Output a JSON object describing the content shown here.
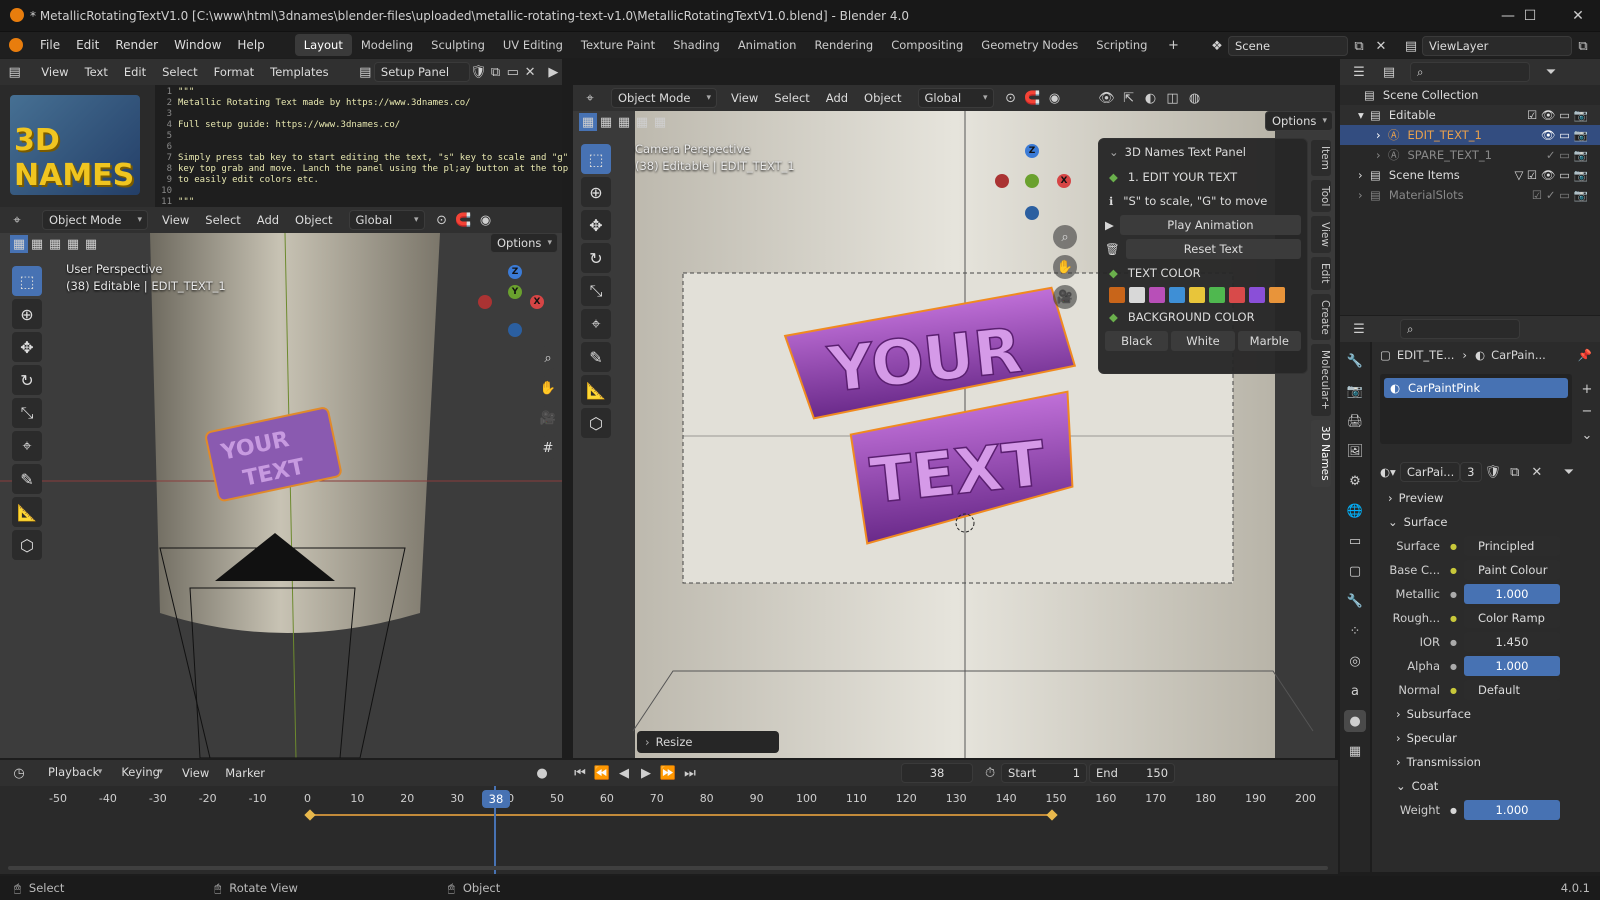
{
  "window": {
    "title": "* MetallicRotatingTextV1.0 [C:\\www\\html\\3dnames\\blender-files\\uploaded\\metallic-rotating-text-v1.0\\MetallicRotatingTextV1.0.blend] - Blender 4.0"
  },
  "menu": [
    "File",
    "Edit",
    "Render",
    "Window",
    "Help"
  ],
  "workspaces": [
    "Layout",
    "Modeling",
    "Sculpting",
    "UV Editing",
    "Texture Paint",
    "Shading",
    "Animation",
    "Rendering",
    "Compositing",
    "Geometry Nodes",
    "Scripting"
  ],
  "active_workspace": "Layout",
  "scene": {
    "name": "Scene",
    "view_layer": "ViewLayer"
  },
  "text_editor": {
    "menus": [
      "View",
      "Text",
      "Edit",
      "Select",
      "Format",
      "Templates"
    ],
    "file": "Setup Panel",
    "lines": [
      {
        "n": "1",
        "t": "\"\"\""
      },
      {
        "n": "2",
        "t": "Metallic Rotating Text made by https://www.3dnames.co/"
      },
      {
        "n": "3",
        "t": ""
      },
      {
        "n": "4",
        "t": "Full setup guide: https://www.3dnames.co/"
      },
      {
        "n": "5",
        "t": ""
      },
      {
        "n": "6",
        "t": ""
      },
      {
        "n": "7",
        "t": "Simply press tab key to start editing the text, \"s\" key to scale and \"g\""
      },
      {
        "n": "8",
        "t": "key top grab and move. Lanch the panel using the pl;ay button at the top"
      },
      {
        "n": "9",
        "t": "to easily edit colors etc."
      },
      {
        "n": "10",
        "t": ""
      },
      {
        "n": "11",
        "t": "\"\"\""
      }
    ]
  },
  "logo": {
    "text": "3D NAMES"
  },
  "left_viewport": {
    "mode": "Object Mode",
    "menus": [
      "View",
      "Select",
      "Add",
      "Object"
    ],
    "transform": "Global",
    "options": "Options",
    "title": "User Perspective",
    "subtitle": "(38) Editable | EDIT_TEXT_1"
  },
  "right_viewport": {
    "mode": "Object Mode",
    "menus": [
      "View",
      "Select",
      "Add",
      "Object"
    ],
    "transform": "Global",
    "options": "Options",
    "title": "Camera Perspective",
    "subtitle": "(38) Editable | EDIT_TEXT_1",
    "resize": "Resize"
  },
  "side_tabs": [
    "Item",
    "Tool",
    "View",
    "Edit",
    "Create",
    "Molecular+",
    "3D Names"
  ],
  "names_panel": {
    "title": "3D Names Text Panel",
    "edit": "1. EDIT YOUR TEXT",
    "hint": "\"S\" to scale, \"G\" to move",
    "play": "Play Animation",
    "reset": "Reset Text",
    "text_color": "TEXT COLOR",
    "bg_color": "BACKGROUND COLOR",
    "bg_options": [
      "Black",
      "White",
      "Marble"
    ],
    "swatches": [
      "#c8651a",
      "#d8d8d8",
      "#b84fb8",
      "#3e8fd6",
      "#e8c53a",
      "#4fb84f",
      "#d84a4a",
      "#8a4fd8",
      "#e8943a"
    ]
  },
  "outliner": {
    "root": "Scene Collection",
    "items": [
      {
        "label": "Editable",
        "level": 1
      },
      {
        "label": "EDIT_TEXT_1",
        "level": 2
      },
      {
        "label": "SPARE_TEXT_1",
        "level": 2
      },
      {
        "label": "Scene Items",
        "level": 1
      },
      {
        "label": "MaterialSlots",
        "level": 1
      }
    ]
  },
  "properties": {
    "breadcrumb_obj": "EDIT_TE...",
    "breadcrumb_mat": "CarPain...",
    "slot": "CarPaintPink",
    "mat_name": "CarPai...",
    "users": "3",
    "sections": {
      "preview": "Preview",
      "surface": "Surface",
      "subsurface": "Subsurface",
      "specular": "Specular",
      "transmission": "Transmission",
      "coat": "Coat"
    },
    "rows": [
      {
        "label": "Surface",
        "value": "Principled BS...",
        "kind": "link"
      },
      {
        "label": "Base C...",
        "value": "Paint Colour",
        "kind": "link"
      },
      {
        "label": "Metallic",
        "value": "1.000",
        "kind": "num"
      },
      {
        "label": "Rough...",
        "value": "Color Ramp",
        "kind": "link"
      },
      {
        "label": "IOR",
        "value": "1.450",
        "kind": "numgray"
      },
      {
        "label": "Alpha",
        "value": "1.000",
        "kind": "num"
      },
      {
        "label": "Normal",
        "value": "Default",
        "kind": "link"
      }
    ],
    "coat_weight": {
      "label": "Weight",
      "value": "1.000"
    }
  },
  "timeline": {
    "menus": [
      "Playback",
      "Keying",
      "View",
      "Marker"
    ],
    "current": "38",
    "start_label": "Start",
    "start": "1",
    "end_label": "End",
    "end": "150",
    "ticks": [
      "-50",
      "-40",
      "-30",
      "-20",
      "-10",
      "0",
      "10",
      "20",
      "30",
      "40",
      "50",
      "60",
      "70",
      "80",
      "90",
      "100",
      "110",
      "120",
      "130",
      "140",
      "150",
      "160",
      "170",
      "180",
      "190",
      "200"
    ]
  },
  "status": {
    "select": "Select",
    "rotate": "Rotate View",
    "object": "Object",
    "version": "4.0.1"
  },
  "text_object": {
    "line1": "YOUR",
    "line2": "TEXT"
  }
}
